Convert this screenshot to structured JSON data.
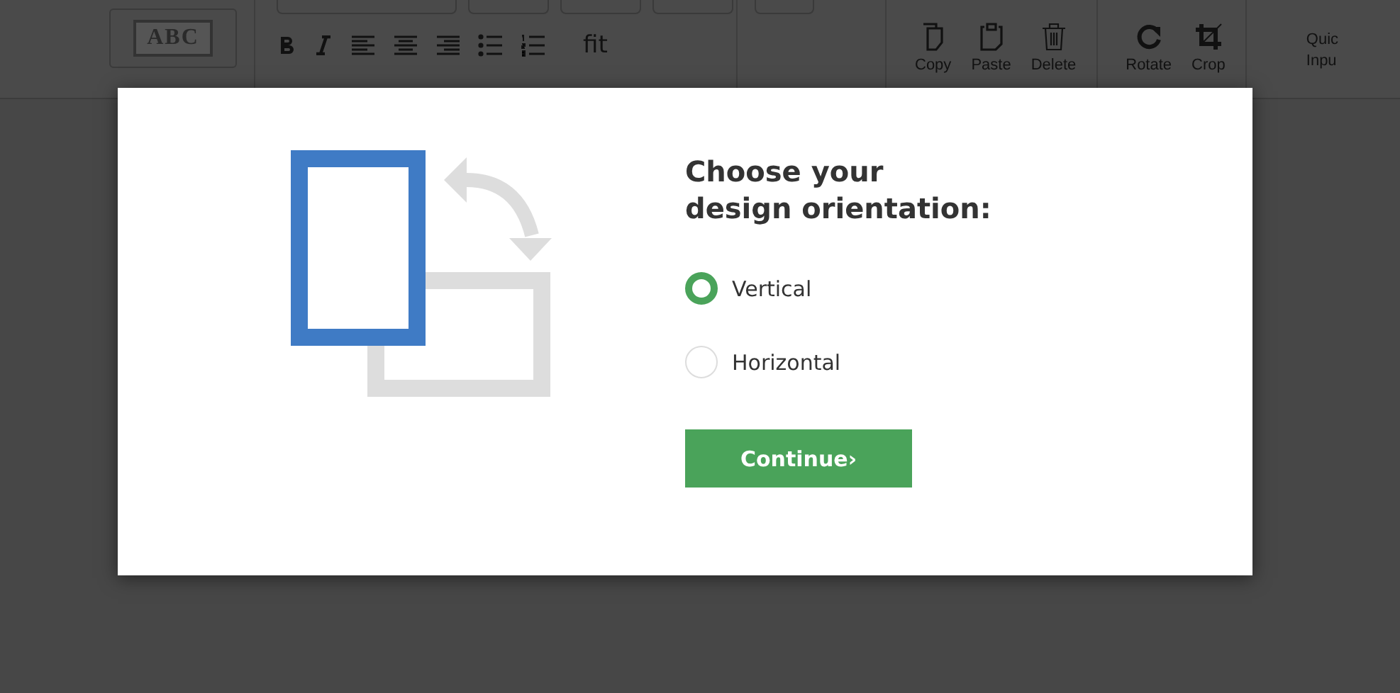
{
  "toolbar": {
    "style_preview": "ABC",
    "format_buttons": [
      {
        "kind": "bold"
      },
      {
        "kind": "italic"
      },
      {
        "kind": "align-left"
      },
      {
        "kind": "align-center"
      },
      {
        "kind": "align-right"
      },
      {
        "kind": "bullet-list"
      },
      {
        "kind": "number-list"
      },
      {
        "kind": "fit",
        "label": "fit"
      }
    ],
    "edit_buttons": [
      {
        "kind": "copy",
        "label": "Copy"
      },
      {
        "kind": "paste",
        "label": "Paste"
      },
      {
        "kind": "delete",
        "label": "Delete"
      }
    ],
    "transform_buttons": [
      {
        "kind": "rotate",
        "label": "Rotate"
      },
      {
        "kind": "crop",
        "label": "Crop"
      }
    ],
    "cut_labels": [
      "Quic",
      "Inpu"
    ]
  },
  "dialog": {
    "title": "Choose your design orientation:",
    "options": [
      {
        "label": "Vertical",
        "selected": true
      },
      {
        "label": "Horizontal",
        "selected": false
      }
    ],
    "button": "Continue",
    "button_icon": "›"
  }
}
